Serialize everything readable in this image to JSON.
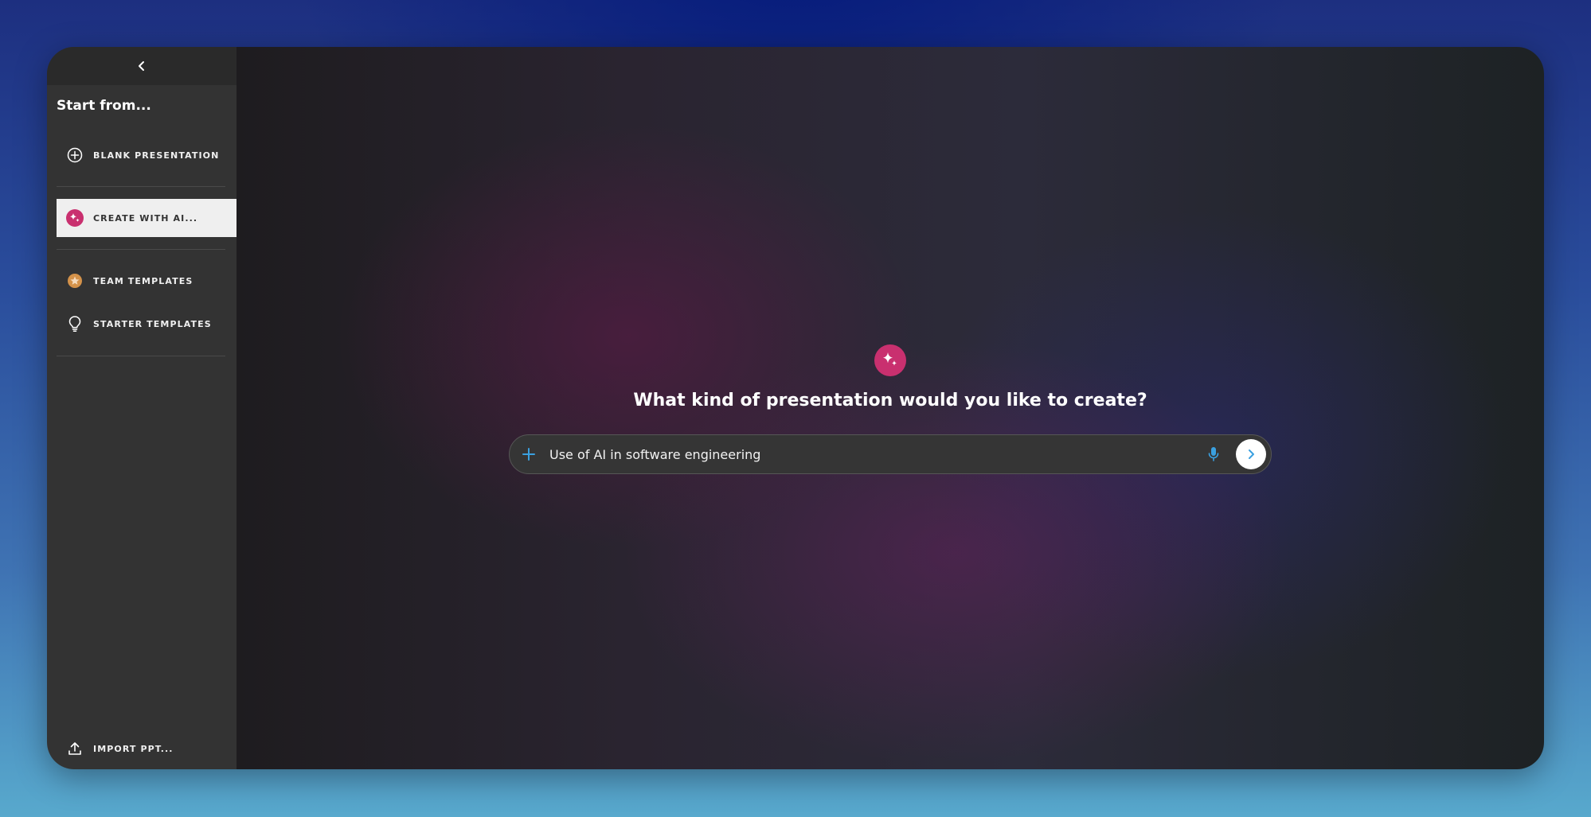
{
  "sidebar": {
    "title": "Start from...",
    "items": [
      {
        "label": "BLANK PRESENTATION",
        "icon": "plus-circle-icon"
      },
      {
        "label": "CREATE WITH AI...",
        "icon": "sparkle-icon",
        "active": true
      },
      {
        "label": "TEAM TEMPLATES",
        "icon": "star-badge-icon"
      },
      {
        "label": "STARTER TEMPLATES",
        "icon": "lightbulb-icon"
      }
    ],
    "import_label": "IMPORT PPT..."
  },
  "main": {
    "prompt_title": "What kind of presentation would you like to create?",
    "input_value": "Use of AI in software engineering"
  },
  "colors": {
    "ai_accent": "#c9306f",
    "team_accent": "#d4924a",
    "input_icon_accent": "#3aa0e0"
  }
}
